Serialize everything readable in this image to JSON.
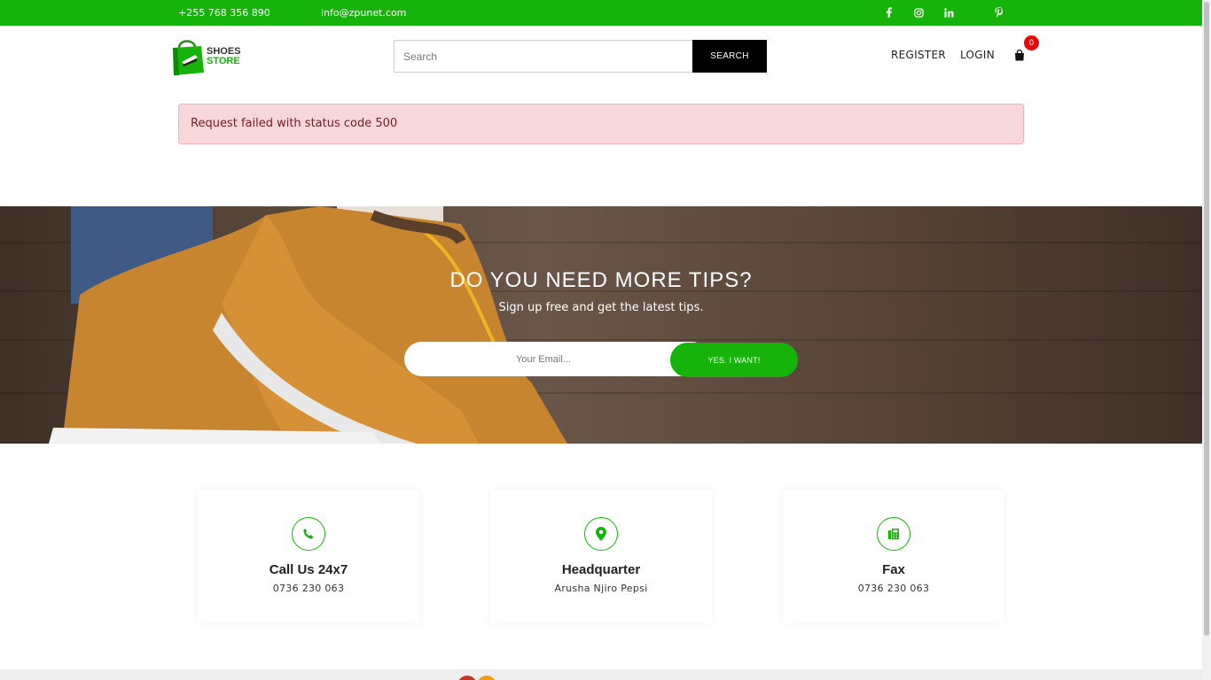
{
  "topbar": {
    "phone": "+255 768 356 890",
    "email": "info@zpunet.com",
    "social": [
      "facebook-icon",
      "instagram-icon",
      "linkedin-icon",
      "pinterest-icon"
    ],
    "bg_color": "#16b30a"
  },
  "header": {
    "logo_line1": "SHOES",
    "logo_line2": "STORE",
    "search_placeholder": "Search",
    "search_button": "SEARCH",
    "register": "REGISTER",
    "login": "LOGIN",
    "cart_count": "0"
  },
  "alert": {
    "message": "Request failed with status code 500"
  },
  "newsletter": {
    "title": "DO YOU NEED MORE TIPS?",
    "subtitle": "Sign up free and get the latest tips.",
    "email_placeholder": "Your Email...",
    "button": "YES. I WANT!"
  },
  "contacts": [
    {
      "icon": "phone-icon",
      "title": "Call Us 24x7",
      "value": "0736 230 063"
    },
    {
      "icon": "map-pin-icon",
      "title": "Headquarter",
      "value": "Arusha Njiro Pepsi"
    },
    {
      "icon": "fax-icon",
      "title": "Fax",
      "value": "0736 230 063"
    }
  ],
  "colors": {
    "accent": "#16b30a",
    "alert_bg": "#f8d7da",
    "alert_text": "#721c24",
    "badge": "#e60a0a"
  }
}
